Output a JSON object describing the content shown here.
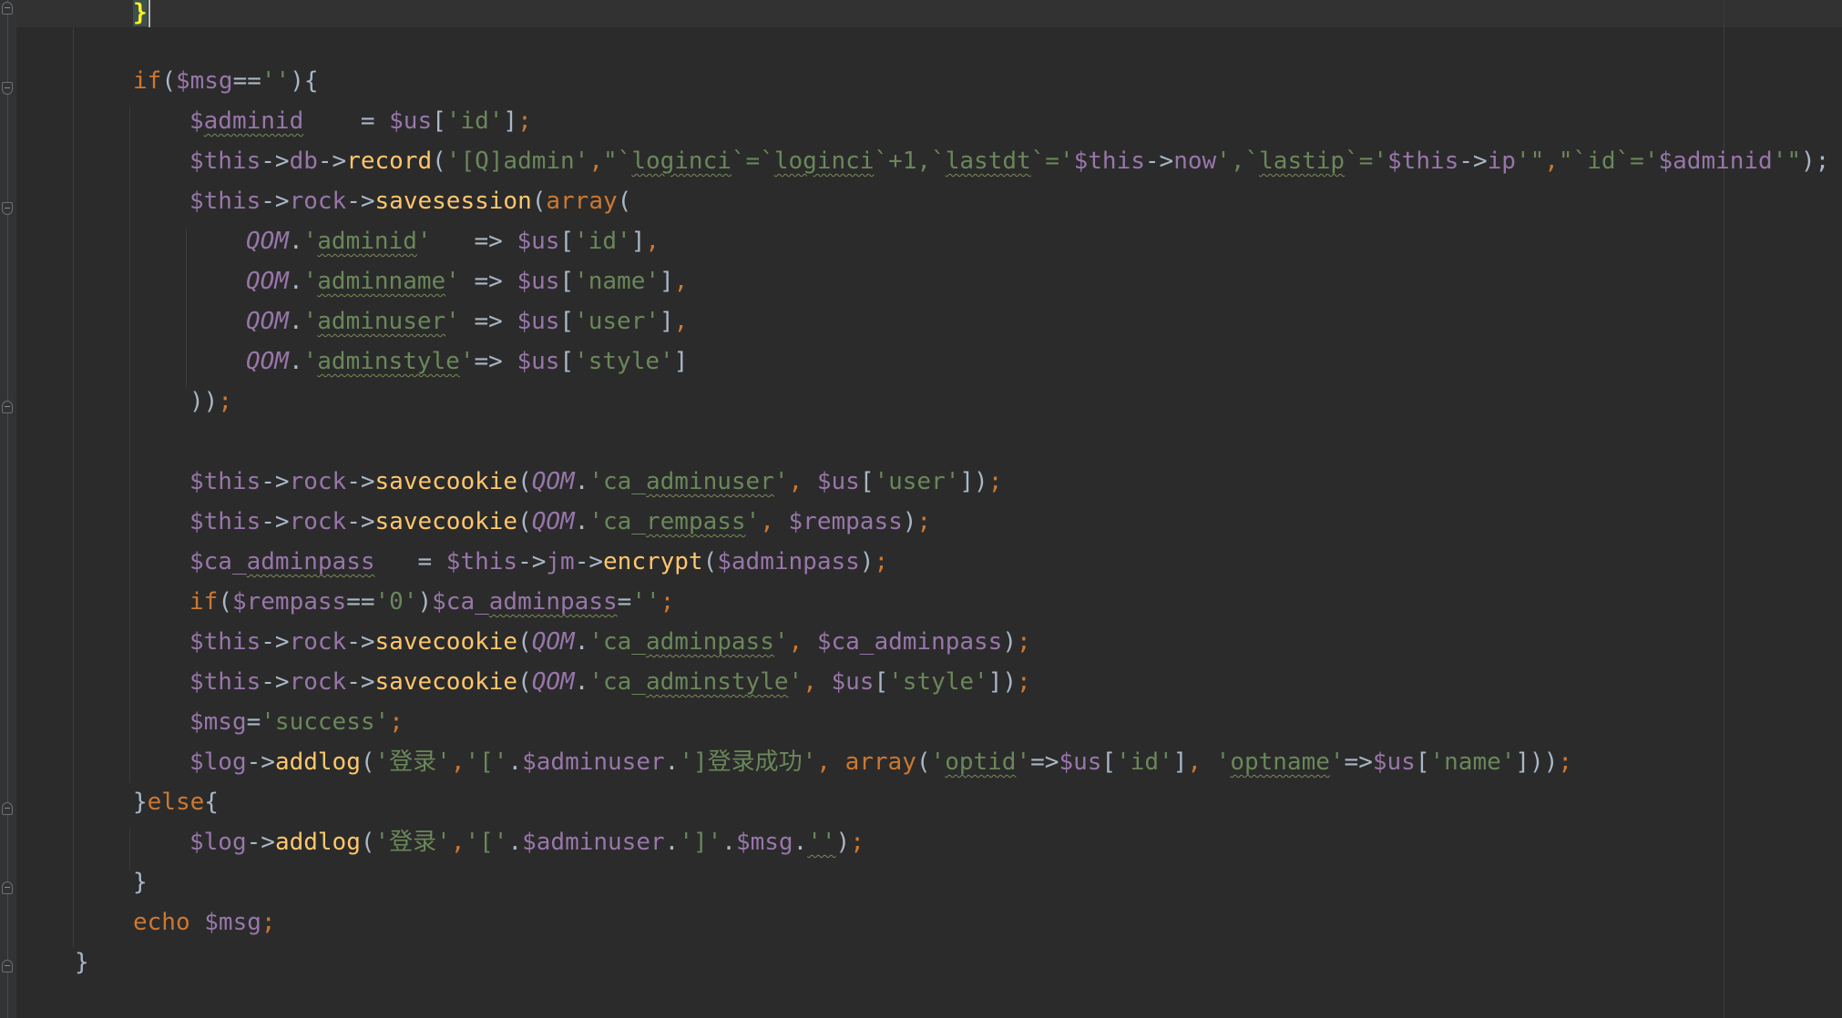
{
  "editor": {
    "lines": [
      [
        {
          "t": "}",
          "c": "brace-hl"
        },
        {
          "t": "",
          "c": "caret"
        }
      ],
      [],
      [
        {
          "t": "if",
          "c": "kw"
        },
        {
          "t": "(",
          "c": "op"
        },
        {
          "t": "$msg",
          "c": "var"
        },
        {
          "t": "==",
          "c": "op"
        },
        {
          "t": "''",
          "c": "str"
        },
        {
          "t": "){",
          "c": "op"
        }
      ],
      [
        {
          "t": "$",
          "c": "var"
        },
        {
          "t": "adminid",
          "c": "var squig"
        },
        {
          "t": "    = ",
          "c": "op"
        },
        {
          "t": "$us",
          "c": "var"
        },
        {
          "t": "[",
          "c": "op"
        },
        {
          "t": "'id'",
          "c": "str"
        },
        {
          "t": "]",
          "c": "op"
        },
        {
          "t": ";",
          "c": "kw"
        }
      ],
      [
        {
          "t": "$this",
          "c": "var"
        },
        {
          "t": "->",
          "c": "op"
        },
        {
          "t": "db",
          "c": "var"
        },
        {
          "t": "->",
          "c": "op"
        },
        {
          "t": "record",
          "c": "fn"
        },
        {
          "t": "(",
          "c": "op"
        },
        {
          "t": "'[Q]admin'",
          "c": "str"
        },
        {
          "t": ",",
          "c": "kw"
        },
        {
          "t": "\"`",
          "c": "str"
        },
        {
          "t": "loginci",
          "c": "str squig"
        },
        {
          "t": "`=`",
          "c": "str"
        },
        {
          "t": "loginci",
          "c": "str squig"
        },
        {
          "t": "`+1,`",
          "c": "str"
        },
        {
          "t": "lastdt",
          "c": "str squig"
        },
        {
          "t": "`='",
          "c": "str"
        },
        {
          "t": "$this",
          "c": "var"
        },
        {
          "t": "->",
          "c": "op"
        },
        {
          "t": "now",
          "c": "var"
        },
        {
          "t": "',`",
          "c": "str"
        },
        {
          "t": "lastip",
          "c": "str squig"
        },
        {
          "t": "`='",
          "c": "str"
        },
        {
          "t": "$this",
          "c": "var"
        },
        {
          "t": "->",
          "c": "op"
        },
        {
          "t": "ip",
          "c": "var"
        },
        {
          "t": "'\"",
          "c": "str"
        },
        {
          "t": ",",
          "c": "kw"
        },
        {
          "t": "\"`id`='",
          "c": "str"
        },
        {
          "t": "$adminid",
          "c": "var"
        },
        {
          "t": "'\"",
          "c": "str"
        },
        {
          "t": ");",
          "c": "op"
        }
      ],
      [
        {
          "t": "$this",
          "c": "var"
        },
        {
          "t": "->",
          "c": "op"
        },
        {
          "t": "rock",
          "c": "var"
        },
        {
          "t": "->",
          "c": "op"
        },
        {
          "t": "savesession",
          "c": "fn"
        },
        {
          "t": "(",
          "c": "op"
        },
        {
          "t": "array",
          "c": "kw"
        },
        {
          "t": "(",
          "c": "op"
        }
      ],
      [
        {
          "t": "QOM",
          "c": "con"
        },
        {
          "t": ".",
          "c": "op"
        },
        {
          "t": "'",
          "c": "str"
        },
        {
          "t": "adminid",
          "c": "str squig"
        },
        {
          "t": "'",
          "c": "str"
        },
        {
          "t": "   => ",
          "c": "op"
        },
        {
          "t": "$us",
          "c": "var"
        },
        {
          "t": "[",
          "c": "op"
        },
        {
          "t": "'id'",
          "c": "str"
        },
        {
          "t": "]",
          "c": "op"
        },
        {
          "t": ",",
          "c": "kw"
        }
      ],
      [
        {
          "t": "QOM",
          "c": "con"
        },
        {
          "t": ".",
          "c": "op"
        },
        {
          "t": "'",
          "c": "str"
        },
        {
          "t": "adminname",
          "c": "str squig"
        },
        {
          "t": "'",
          "c": "str"
        },
        {
          "t": " => ",
          "c": "op"
        },
        {
          "t": "$us",
          "c": "var"
        },
        {
          "t": "[",
          "c": "op"
        },
        {
          "t": "'name'",
          "c": "str"
        },
        {
          "t": "]",
          "c": "op"
        },
        {
          "t": ",",
          "c": "kw"
        }
      ],
      [
        {
          "t": "QOM",
          "c": "con"
        },
        {
          "t": ".",
          "c": "op"
        },
        {
          "t": "'",
          "c": "str"
        },
        {
          "t": "adminuser",
          "c": "str squig"
        },
        {
          "t": "'",
          "c": "str"
        },
        {
          "t": " => ",
          "c": "op"
        },
        {
          "t": "$us",
          "c": "var"
        },
        {
          "t": "[",
          "c": "op"
        },
        {
          "t": "'user'",
          "c": "str"
        },
        {
          "t": "]",
          "c": "op"
        },
        {
          "t": ",",
          "c": "kw"
        }
      ],
      [
        {
          "t": "QOM",
          "c": "con"
        },
        {
          "t": ".",
          "c": "op"
        },
        {
          "t": "'",
          "c": "str"
        },
        {
          "t": "adminstyle",
          "c": "str squig"
        },
        {
          "t": "'",
          "c": "str"
        },
        {
          "t": "=> ",
          "c": "op"
        },
        {
          "t": "$us",
          "c": "var"
        },
        {
          "t": "[",
          "c": "op"
        },
        {
          "t": "'style'",
          "c": "str"
        },
        {
          "t": "]",
          "c": "op"
        }
      ],
      [
        {
          "t": "))",
          "c": "op"
        },
        {
          "t": ";",
          "c": "kw"
        }
      ],
      [],
      [
        {
          "t": "$this",
          "c": "var"
        },
        {
          "t": "->",
          "c": "op"
        },
        {
          "t": "rock",
          "c": "var"
        },
        {
          "t": "->",
          "c": "op"
        },
        {
          "t": "savecookie",
          "c": "fn"
        },
        {
          "t": "(",
          "c": "op"
        },
        {
          "t": "QOM",
          "c": "con"
        },
        {
          "t": ".",
          "c": "op"
        },
        {
          "t": "'ca_",
          "c": "str"
        },
        {
          "t": "adminuser",
          "c": "str squig"
        },
        {
          "t": "'",
          "c": "str"
        },
        {
          "t": ", ",
          "c": "kw"
        },
        {
          "t": "$us",
          "c": "var"
        },
        {
          "t": "[",
          "c": "op"
        },
        {
          "t": "'user'",
          "c": "str"
        },
        {
          "t": "])",
          "c": "op"
        },
        {
          "t": ";",
          "c": "kw"
        }
      ],
      [
        {
          "t": "$this",
          "c": "var"
        },
        {
          "t": "->",
          "c": "op"
        },
        {
          "t": "rock",
          "c": "var"
        },
        {
          "t": "->",
          "c": "op"
        },
        {
          "t": "savecookie",
          "c": "fn"
        },
        {
          "t": "(",
          "c": "op"
        },
        {
          "t": "QOM",
          "c": "con"
        },
        {
          "t": ".",
          "c": "op"
        },
        {
          "t": "'ca_",
          "c": "str"
        },
        {
          "t": "rempass",
          "c": "str squig"
        },
        {
          "t": "'",
          "c": "str"
        },
        {
          "t": ", ",
          "c": "kw"
        },
        {
          "t": "$rempass",
          "c": "var"
        },
        {
          "t": ")",
          "c": "op"
        },
        {
          "t": ";",
          "c": "kw"
        }
      ],
      [
        {
          "t": "$ca_",
          "c": "var"
        },
        {
          "t": "adminpass",
          "c": "var squig"
        },
        {
          "t": "   = ",
          "c": "op"
        },
        {
          "t": "$this",
          "c": "var"
        },
        {
          "t": "->",
          "c": "op"
        },
        {
          "t": "jm",
          "c": "var"
        },
        {
          "t": "->",
          "c": "op"
        },
        {
          "t": "encrypt",
          "c": "fn"
        },
        {
          "t": "(",
          "c": "op"
        },
        {
          "t": "$adminpass",
          "c": "var"
        },
        {
          "t": ")",
          "c": "op"
        },
        {
          "t": ";",
          "c": "kw"
        }
      ],
      [
        {
          "t": "if",
          "c": "kw"
        },
        {
          "t": "(",
          "c": "op"
        },
        {
          "t": "$rempass",
          "c": "var"
        },
        {
          "t": "==",
          "c": "op"
        },
        {
          "t": "'0'",
          "c": "str"
        },
        {
          "t": ")",
          "c": "op"
        },
        {
          "t": "$ca_",
          "c": "var"
        },
        {
          "t": "adminpass",
          "c": "var squig"
        },
        {
          "t": "=",
          "c": "op"
        },
        {
          "t": "''",
          "c": "str"
        },
        {
          "t": ";",
          "c": "kw"
        }
      ],
      [
        {
          "t": "$this",
          "c": "var"
        },
        {
          "t": "->",
          "c": "op"
        },
        {
          "t": "rock",
          "c": "var"
        },
        {
          "t": "->",
          "c": "op"
        },
        {
          "t": "savecookie",
          "c": "fn"
        },
        {
          "t": "(",
          "c": "op"
        },
        {
          "t": "QOM",
          "c": "con"
        },
        {
          "t": ".",
          "c": "op"
        },
        {
          "t": "'ca_",
          "c": "str"
        },
        {
          "t": "adminpass",
          "c": "str squig"
        },
        {
          "t": "'",
          "c": "str"
        },
        {
          "t": ", ",
          "c": "kw"
        },
        {
          "t": "$ca_adminpass",
          "c": "var"
        },
        {
          "t": ")",
          "c": "op"
        },
        {
          "t": ";",
          "c": "kw"
        }
      ],
      [
        {
          "t": "$this",
          "c": "var"
        },
        {
          "t": "->",
          "c": "op"
        },
        {
          "t": "rock",
          "c": "var"
        },
        {
          "t": "->",
          "c": "op"
        },
        {
          "t": "savecookie",
          "c": "fn"
        },
        {
          "t": "(",
          "c": "op"
        },
        {
          "t": "QOM",
          "c": "con"
        },
        {
          "t": ".",
          "c": "op"
        },
        {
          "t": "'ca_",
          "c": "str"
        },
        {
          "t": "adminstyle",
          "c": "str squig"
        },
        {
          "t": "'",
          "c": "str"
        },
        {
          "t": ", ",
          "c": "kw"
        },
        {
          "t": "$us",
          "c": "var"
        },
        {
          "t": "[",
          "c": "op"
        },
        {
          "t": "'style'",
          "c": "str"
        },
        {
          "t": "])",
          "c": "op"
        },
        {
          "t": ";",
          "c": "kw"
        }
      ],
      [
        {
          "t": "$msg",
          "c": "var"
        },
        {
          "t": "=",
          "c": "op"
        },
        {
          "t": "'success'",
          "c": "str"
        },
        {
          "t": ";",
          "c": "kw"
        }
      ],
      [
        {
          "t": "$log",
          "c": "var"
        },
        {
          "t": "->",
          "c": "op"
        },
        {
          "t": "addlog",
          "c": "fn"
        },
        {
          "t": "(",
          "c": "op"
        },
        {
          "t": "'登录'",
          "c": "str"
        },
        {
          "t": ",",
          "c": "kw"
        },
        {
          "t": "'['",
          "c": "str"
        },
        {
          "t": ".",
          "c": "op"
        },
        {
          "t": "$adminuser",
          "c": "var"
        },
        {
          "t": ".",
          "c": "op"
        },
        {
          "t": "']登录成功'",
          "c": "str"
        },
        {
          "t": ", ",
          "c": "kw"
        },
        {
          "t": "array",
          "c": "kw"
        },
        {
          "t": "(",
          "c": "op"
        },
        {
          "t": "'",
          "c": "str"
        },
        {
          "t": "optid",
          "c": "str squig"
        },
        {
          "t": "'",
          "c": "str"
        },
        {
          "t": "=>",
          "c": "op"
        },
        {
          "t": "$us",
          "c": "var"
        },
        {
          "t": "[",
          "c": "op"
        },
        {
          "t": "'id'",
          "c": "str"
        },
        {
          "t": "]",
          "c": "op"
        },
        {
          "t": ", ",
          "c": "kw"
        },
        {
          "t": "'",
          "c": "str"
        },
        {
          "t": "optname",
          "c": "str squig"
        },
        {
          "t": "'",
          "c": "str"
        },
        {
          "t": "=>",
          "c": "op"
        },
        {
          "t": "$us",
          "c": "var"
        },
        {
          "t": "[",
          "c": "op"
        },
        {
          "t": "'name'",
          "c": "str"
        },
        {
          "t": "]))",
          "c": "op"
        },
        {
          "t": ";",
          "c": "kw"
        }
      ],
      [
        {
          "t": "}",
          "c": "op"
        },
        {
          "t": "else",
          "c": "kw"
        },
        {
          "t": "{",
          "c": "op"
        }
      ],
      [
        {
          "t": "$log",
          "c": "var"
        },
        {
          "t": "->",
          "c": "op"
        },
        {
          "t": "addlog",
          "c": "fn"
        },
        {
          "t": "(",
          "c": "op"
        },
        {
          "t": "'登录'",
          "c": "str"
        },
        {
          "t": ",",
          "c": "kw"
        },
        {
          "t": "'['",
          "c": "str"
        },
        {
          "t": ".",
          "c": "op"
        },
        {
          "t": "$adminuser",
          "c": "var"
        },
        {
          "t": ".",
          "c": "op"
        },
        {
          "t": "']'",
          "c": "str"
        },
        {
          "t": ".",
          "c": "op"
        },
        {
          "t": "$msg",
          "c": "var"
        },
        {
          "t": ".",
          "c": "op"
        },
        {
          "t": "''",
          "c": "str squig"
        },
        {
          "t": ")",
          "c": "op"
        },
        {
          "t": ";",
          "c": "kw"
        }
      ],
      [
        {
          "t": "}",
          "c": "op"
        }
      ],
      [
        {
          "t": "echo",
          "c": "kw"
        },
        {
          "t": " ",
          "c": "op"
        },
        {
          "t": "$msg",
          "c": "var"
        },
        {
          "t": ";",
          "c": "kw"
        }
      ],
      [
        {
          "t": "}",
          "c": "op"
        }
      ]
    ]
  }
}
